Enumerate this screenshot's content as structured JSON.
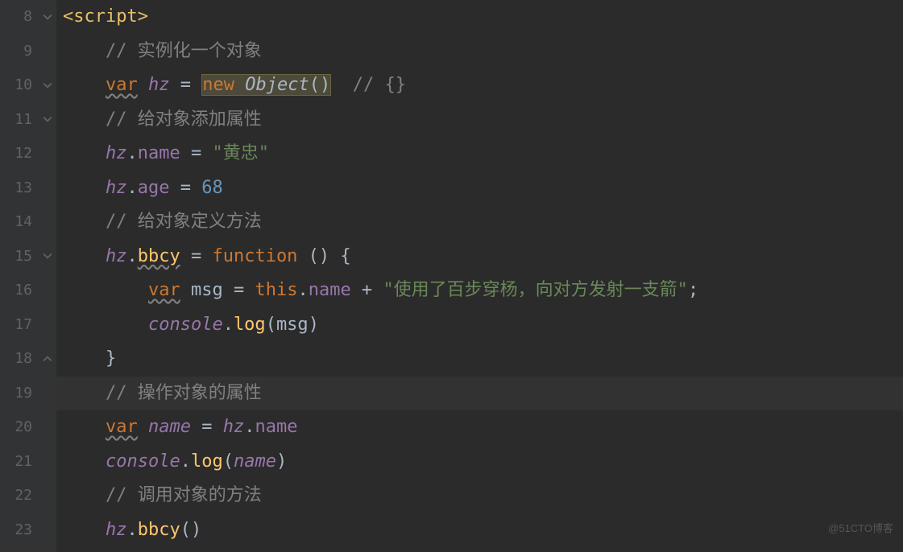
{
  "gutter": {
    "lines": [
      "8",
      "9",
      "10",
      "11",
      "12",
      "13",
      "14",
      "15",
      "16",
      "17",
      "18",
      "19",
      "20",
      "21",
      "22",
      "23"
    ]
  },
  "code": {
    "l8": {
      "tag_open": "<",
      "tag_name": "script",
      "tag_close": ">"
    },
    "l9": {
      "comment_marker": "//",
      "comment_text": " 实例化一个对象"
    },
    "l10": {
      "kw_var": "var",
      "ident": "hz",
      "eq": " = ",
      "kw_new": "new",
      "cls": "Object",
      "parens": "()",
      "comment_marker": "//",
      "comment_text": " {}"
    },
    "l11": {
      "comment_marker": "//",
      "comment_text": " 给对象添加属性"
    },
    "l12": {
      "ident": "hz",
      "dot": ".",
      "prop": "name",
      "eq": " = ",
      "str": "\"黄忠\""
    },
    "l13": {
      "ident": "hz",
      "dot": ".",
      "prop": "age",
      "eq": " = ",
      "num": "68"
    },
    "l14": {
      "comment_marker": "//",
      "comment_text": " 给对象定义方法"
    },
    "l15": {
      "ident": "hz",
      "dot": ".",
      "prop": "bbcy",
      "eq": " = ",
      "kw_func": "function",
      "parens": " () ",
      "brace": "{"
    },
    "l16": {
      "kw_var": "var",
      "ident": "msg",
      "eq": " = ",
      "this": "this",
      "dot": ".",
      "prop": "name",
      "plus": " + ",
      "str": "\"使用了百步穿杨，向对方发射一支箭\"",
      "semi": ";"
    },
    "l17": {
      "obj": "console",
      "dot": ".",
      "method": "log",
      "open": "(",
      "arg": "msg",
      "close": ")"
    },
    "l18": {
      "brace": "}"
    },
    "l19": {
      "comment_marker": "//",
      "comment_text": " 操作对象的属性"
    },
    "l20": {
      "kw_var": "var",
      "ident": "name",
      "eq": " = ",
      "obj": "hz",
      "dot": ".",
      "prop": "name"
    },
    "l21": {
      "obj": "console",
      "dot": ".",
      "method": "log",
      "open": "(",
      "arg": "name",
      "close": ")"
    },
    "l22": {
      "comment_marker": "//",
      "comment_text": " 调用对象的方法"
    },
    "l23": {
      "ident": "hz",
      "dot": ".",
      "method": "bbcy",
      "parens": "()"
    }
  },
  "watermark": "@51CTO博客"
}
